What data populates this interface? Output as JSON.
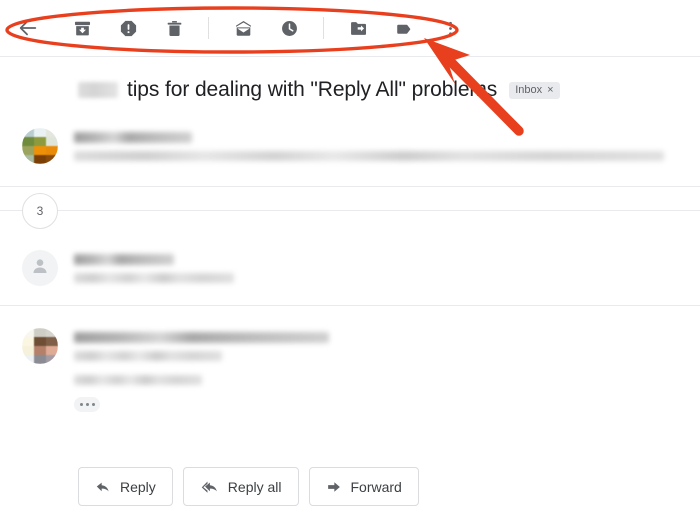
{
  "toolbar": {
    "back_label": "Back",
    "items": [
      {
        "name": "back-arrow-icon",
        "label": "Back"
      },
      {
        "name": "archive-icon",
        "label": "Archive"
      },
      {
        "name": "report-spam-icon",
        "label": "Report spam"
      },
      {
        "name": "delete-icon",
        "label": "Delete"
      },
      {
        "name": "mark-unread-icon",
        "label": "Mark as unread"
      },
      {
        "name": "snooze-clock-icon",
        "label": "Snooze"
      },
      {
        "name": "move-to-folder-icon",
        "label": "Move to"
      },
      {
        "name": "labels-tag-icon",
        "label": "Labels"
      },
      {
        "name": "more-options-icon",
        "label": "More"
      }
    ]
  },
  "subject": {
    "redacted_prefix": "",
    "text": "tips for dealing with \"Reply All\" problems",
    "chip_label": "Inbox",
    "chip_close": "×"
  },
  "thread": {
    "collapsed_count": "3",
    "messages": [
      {
        "avatar_type": "mosaic",
        "has_name": true,
        "has_body": true
      },
      {
        "avatar_type": "default",
        "has_name": true,
        "has_body": true
      },
      {
        "avatar_type": "photo",
        "has_name": true,
        "has_body": true,
        "has_trimmed_content": true
      }
    ]
  },
  "actions": [
    {
      "name": "reply-button",
      "label": "Reply",
      "icon": "reply-arrow-icon"
    },
    {
      "name": "reply-all-button",
      "label": "Reply all",
      "icon": "reply-all-arrow-icon"
    },
    {
      "name": "forward-button",
      "label": "Forward",
      "icon": "forward-arrow-icon"
    }
  ],
  "annotation": {
    "color": "#e8401f",
    "shapes": [
      "ellipse-highlight",
      "pointer-arrow"
    ]
  }
}
